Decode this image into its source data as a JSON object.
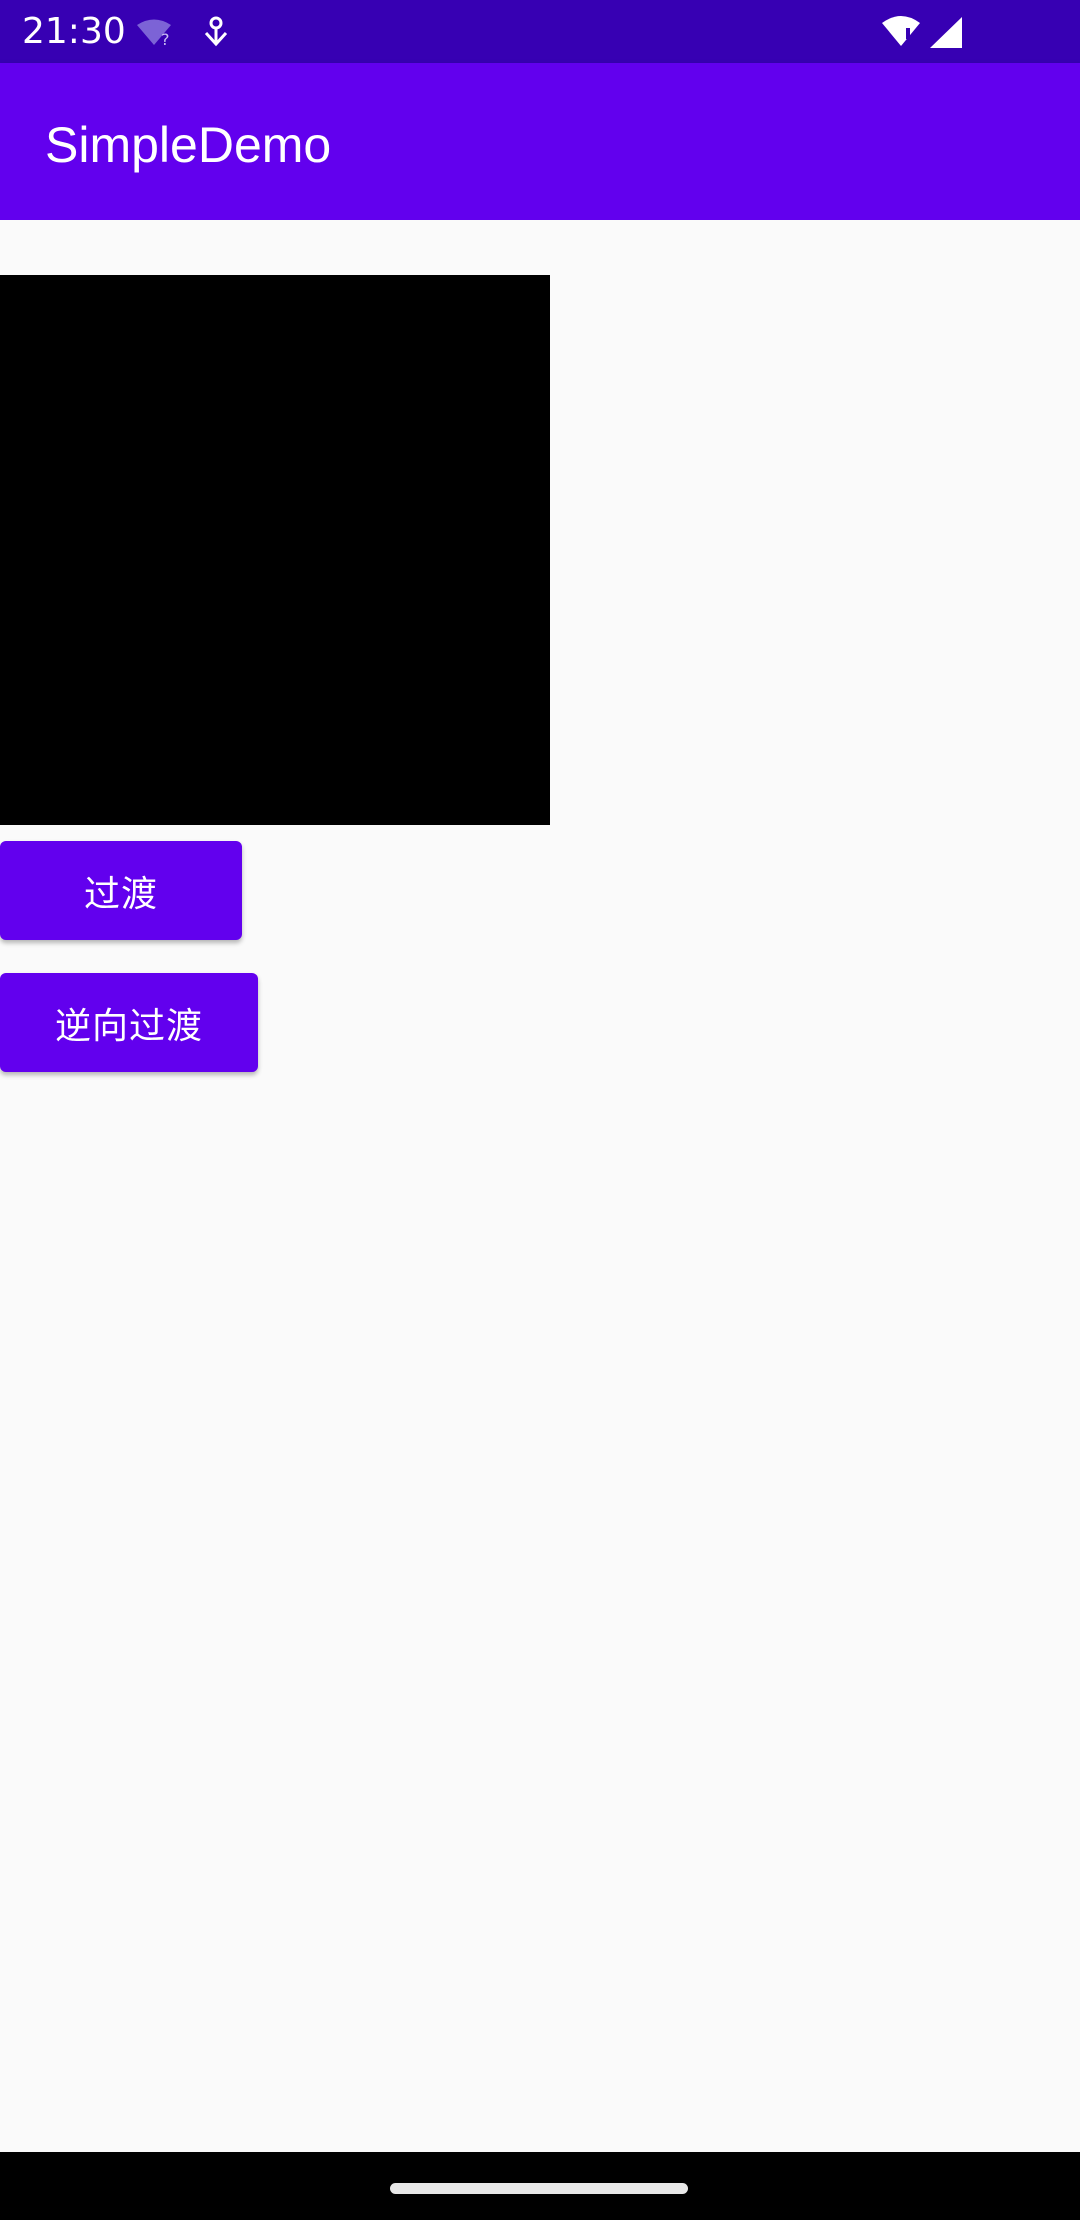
{
  "status_bar": {
    "time": "21:30",
    "icons": [
      "wifi-unknown-icon",
      "download-icon",
      "wifi-alert-icon",
      "signal-icon"
    ],
    "background": "#3700b3"
  },
  "app_bar": {
    "title": "SimpleDemo",
    "background": "#6200ee"
  },
  "content": {
    "view_color": "#000000",
    "buttons": [
      {
        "label": "过渡"
      },
      {
        "label": "逆向过渡"
      }
    ],
    "button_color": "#6200ee"
  },
  "nav_bar": {
    "handle": "home-handle"
  }
}
